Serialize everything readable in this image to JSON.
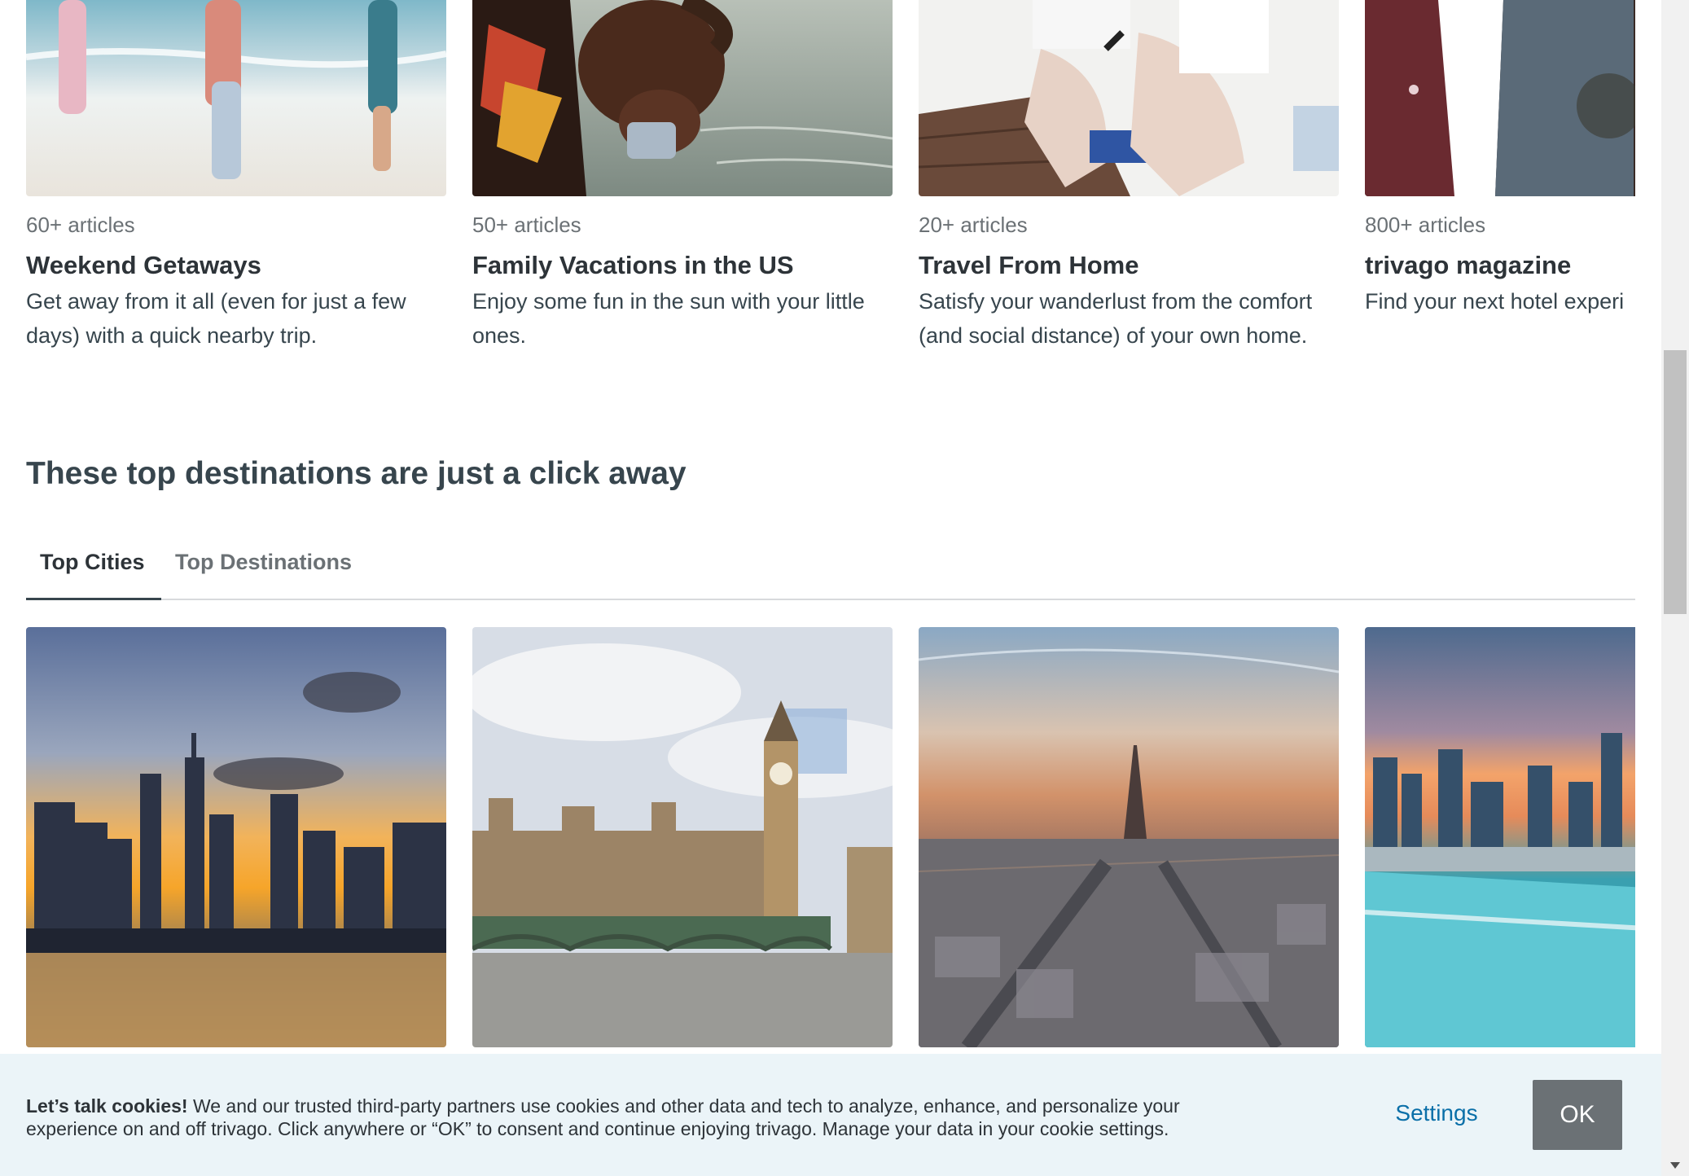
{
  "articles": [
    {
      "count": "60+ articles",
      "title": "Weekend Getaways",
      "desc": "Get away from it all (even for just a few days) with a quick nearby trip."
    },
    {
      "count": "50+ articles",
      "title": "Family Vacations in the US",
      "desc": "Enjoy some fun in the sun with your little ones."
    },
    {
      "count": "20+ articles",
      "title": "Travel From Home",
      "desc": "Satisfy your wanderlust from the comfort (and social distance) of your own home."
    },
    {
      "count": "800+ articles",
      "title": "trivago magazine",
      "desc": "Find your next hotel experi"
    }
  ],
  "section": {
    "title": "These top destinations are just a click away"
  },
  "tabs": [
    {
      "label": "Top Cities",
      "active": true
    },
    {
      "label": "Top Destinations",
      "active": false
    }
  ],
  "cookie": {
    "bold": "Let’s talk cookies!",
    "text": " We and our trusted third-party partners use cookies and other data and tech to analyze, enhance, and personalize your experience on and off trivago. Click anywhere or “OK” to consent and continue enjoying trivago. Manage your data in your cookie settings.",
    "settings_label": "Settings",
    "ok_label": "OK"
  },
  "colors": {
    "accent": "#0a6fa8",
    "ok_button": "#6b7175",
    "banner_bg": "#ebf4f8",
    "text": "#37454d"
  }
}
